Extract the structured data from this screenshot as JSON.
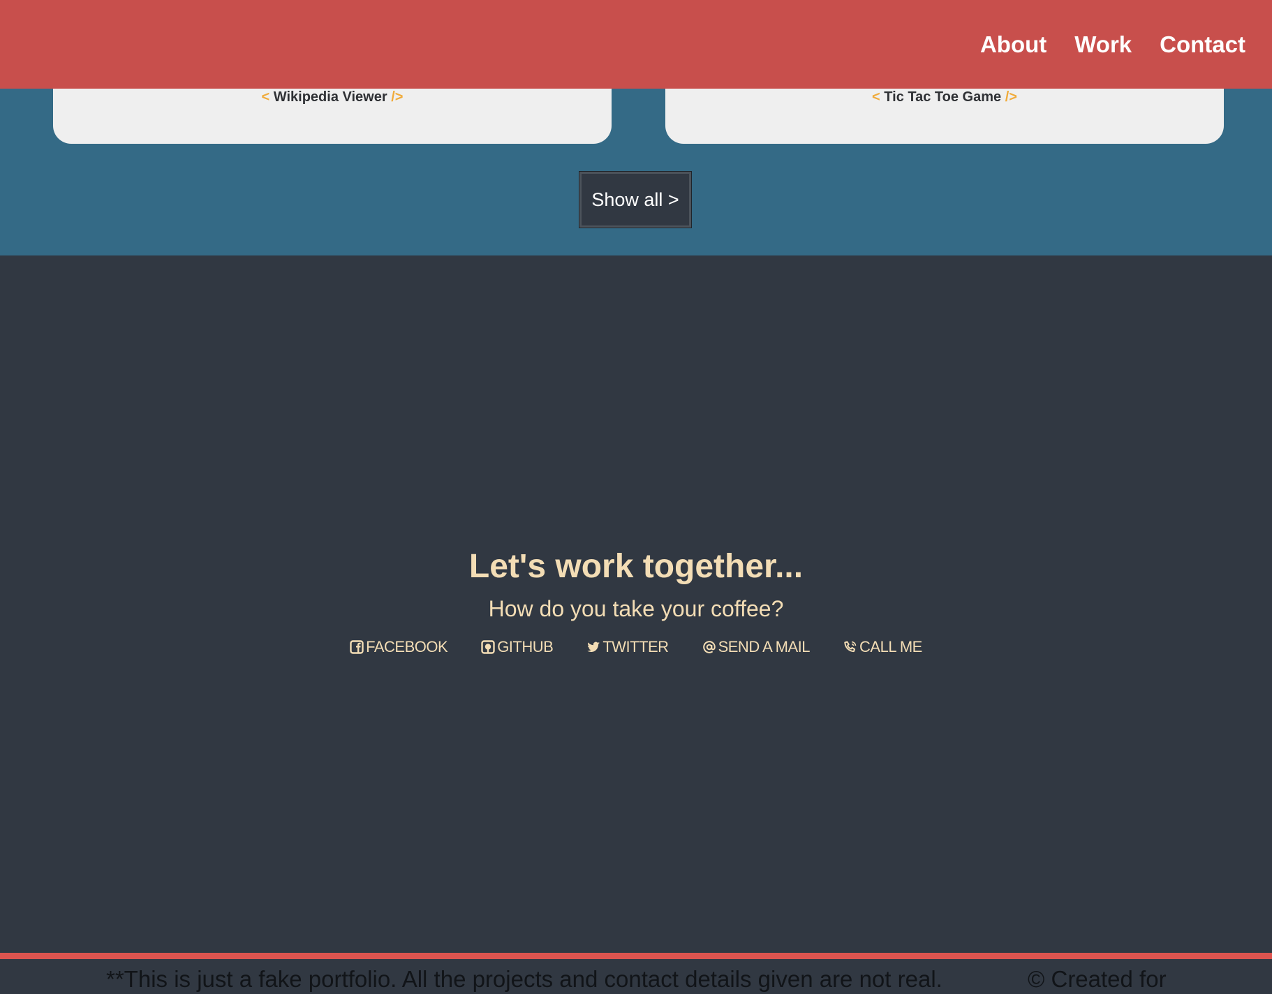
{
  "nav": {
    "links": [
      "About",
      "Work",
      "Contact"
    ]
  },
  "projects": {
    "cards": [
      {
        "open_tag": "<",
        "title": "Wikipedia Viewer",
        "close_tag": "/>"
      },
      {
        "open_tag": "<",
        "title": "Tic Tac Toe Game",
        "close_tag": "/>"
      }
    ],
    "show_all_label": "Show all >"
  },
  "contact": {
    "heading": "Let's work together...",
    "subheading": "How do you take your coffee?",
    "links": [
      {
        "icon": "facebook-icon",
        "label": "FACEBOOK"
      },
      {
        "icon": "github-icon",
        "label": "GITHUB"
      },
      {
        "icon": "twitter-icon",
        "label": "TWITTER"
      },
      {
        "icon": "at-icon",
        "label": "SEND A MAIL"
      },
      {
        "icon": "phone-icon",
        "label": "CALL ME"
      }
    ]
  },
  "footer": {
    "note": "**This is just a fake portfolio. All the projects and contact details given are not real.",
    "credit": "© Created for"
  },
  "colors": {
    "navbar": "#c84f4c",
    "projects_bg": "#346a86",
    "dark_bg": "#313842",
    "accent_text": "#f3ddb5",
    "tag": "#f0ab3a",
    "footer_line": "#dd544f"
  }
}
